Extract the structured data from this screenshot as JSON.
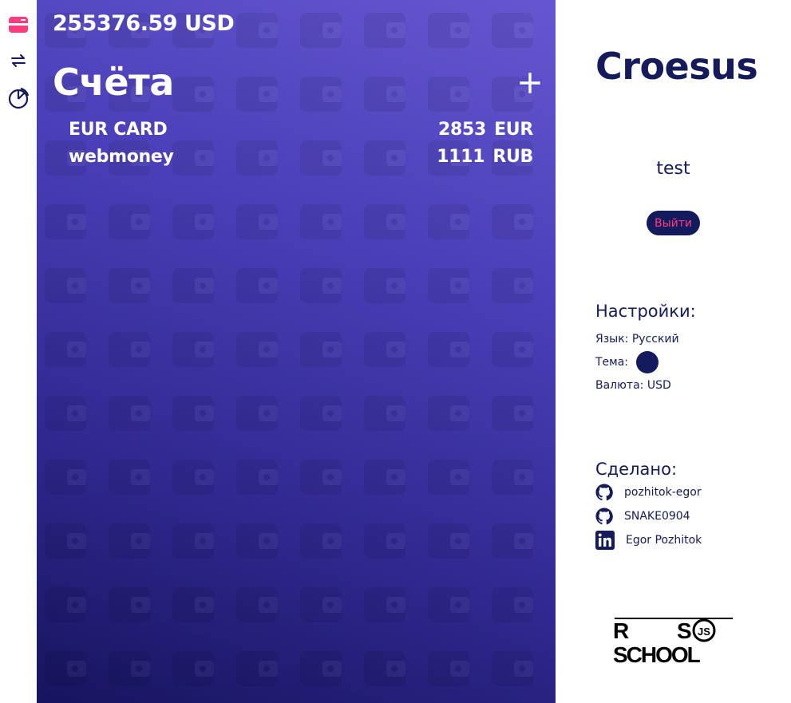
{
  "nav": {
    "items": [
      {
        "icon": "card-icon",
        "active": true
      },
      {
        "icon": "transfer-arrows-icon",
        "active": false
      },
      {
        "icon": "pie-chart-icon",
        "active": false
      }
    ],
    "active_color": "#ff3c7d"
  },
  "main": {
    "total": "255376.59 USD",
    "accounts_title": "Счёта",
    "add_icon": "plus-icon",
    "accounts": [
      {
        "name": "EUR CARD",
        "amount": "2853",
        "currency": "EUR"
      },
      {
        "name": "webmoney",
        "amount": "1111",
        "currency": "RUB"
      }
    ],
    "gradient_top": "#6557d0",
    "gradient_bottom": "#17145e"
  },
  "side": {
    "brand": "Croesus",
    "username": "test",
    "logout_label": "Выйти",
    "settings": {
      "title": "Настройки:",
      "language": "Язык: Русский",
      "theme_label": "Тема:",
      "theme_color": "#141a5e",
      "currency": "Валюта: USD"
    },
    "credits": {
      "title": "Сделано:",
      "items": [
        {
          "icon": "github-icon",
          "label": "pozhitok-egor"
        },
        {
          "icon": "github-icon",
          "label": "SNAKE0904"
        },
        {
          "icon": "linkedin-icon",
          "label": "Egor Pozhitok"
        }
      ]
    },
    "logo_text_top": "RS",
    "logo_text_bottom": "SCHOOL",
    "logo_badge": "JS",
    "text_color": "#151a5c"
  }
}
